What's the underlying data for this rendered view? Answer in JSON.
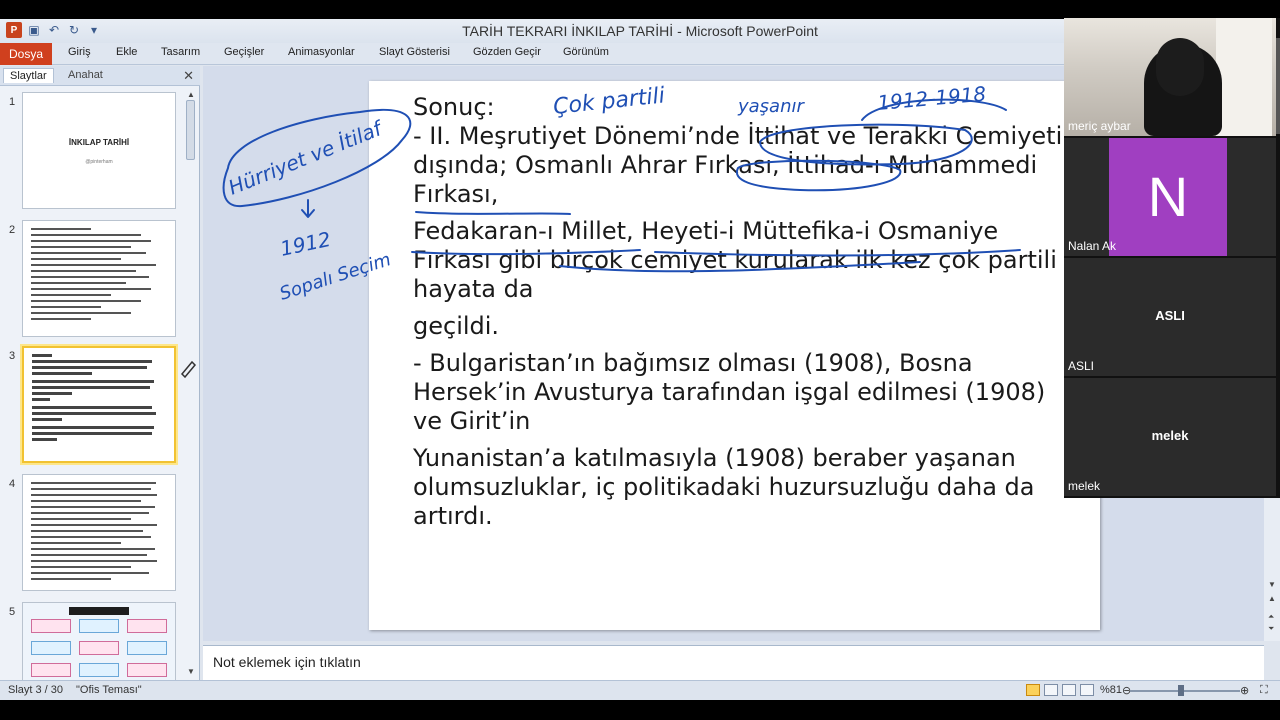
{
  "app": {
    "window_title": "TARİH TEKRARI İNKILAP TARİHİ  -  Microsoft PowerPoint"
  },
  "ribbon": {
    "tabs": [
      "Dosya",
      "Giriş",
      "Ekle",
      "Tasarım",
      "Geçişler",
      "Animasyonlar",
      "Slayt Gösterisi",
      "Gözden Geçir",
      "Görünüm"
    ]
  },
  "left_pane": {
    "tab_slides": "Slaytlar",
    "tab_outline": "Anahat",
    "thumbnails": [
      {
        "number": "1",
        "title": "İNKILAP TARİHİ",
        "subtitle": "@pinterham"
      },
      {
        "number": "2"
      },
      {
        "number": "3"
      },
      {
        "number": "4"
      },
      {
        "number": "5"
      }
    ]
  },
  "slide": {
    "heading": "Sonuç:",
    "paragraphs": [
      "- II. Meşrutiyet Dönemi’nde İttihat ve Terakki Cemiyeti dışında; Osmanlı Ahrar Fırkası, İttihad-ı Muhammedi Fırkası,",
      "Fedakaran-ı Millet, Heyeti-i Müttefika-i Osmaniye Fırkası gibi birçok cemiyet kurularak ilk kez çok partili hayata da",
      "geçildi.",
      "- Bulgaristan’ın bağımsız olması (1908), Bosna Hersek’in Avusturya tarafından işgal edilmesi (1908) ve Girit’in",
      "Yunanistan’a katılmasıyla (1908) beraber yaşanan olumsuzluklar, iç politikadaki huzursuzluğu daha da artırdı."
    ],
    "handwriting": {
      "cok_partili": "Çok partili",
      "yasanir": "yaşanır",
      "dates": "1912-1918",
      "hurriyet": "Hürriyet ve İtilaf",
      "year": "1912",
      "sopali": "Sopalı Seçim"
    }
  },
  "notes": {
    "placeholder": "Not eklemek için tıklatın"
  },
  "status": {
    "slide_counter": "Slayt 3 / 30",
    "theme": "\"Ofis Teması\"",
    "zoom": "%81"
  },
  "participants": [
    {
      "name": "meriç aybar",
      "type": "camera"
    },
    {
      "name": "Nalan Ak",
      "initial": "N",
      "type": "avatar"
    },
    {
      "name": "ASLI",
      "type": "name"
    },
    {
      "name": "melek",
      "type": "name"
    }
  ],
  "colors": {
    "file_tab": "#d0401e",
    "ink": "#1f4fb4",
    "avatar_purple": "#a03fc1",
    "selected_thumb": "#f1c232"
  }
}
